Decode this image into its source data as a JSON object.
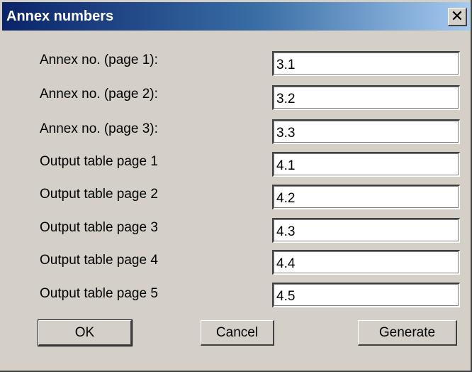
{
  "window": {
    "title": "Annex numbers",
    "close_glyph": "✕"
  },
  "rows": [
    {
      "label": "Annex no. (page 1):",
      "value": "3.1"
    },
    {
      "label": "Annex no. (page 2):",
      "value": "3.2"
    },
    {
      "label": "Annex no. (page 3):",
      "value": "3.3"
    },
    {
      "label": "Output table page  1",
      "value": "4.1"
    },
    {
      "label": "Output table page  2",
      "value": "4.2"
    },
    {
      "label": "Output table page  3",
      "value": "4.3"
    },
    {
      "label": "Output table page  4",
      "value": "4.4"
    },
    {
      "label": "Output table page  5",
      "value": "4.5"
    }
  ],
  "buttons": {
    "ok": "OK",
    "cancel": "Cancel",
    "generate": "Generate"
  },
  "colors": {
    "title_gradient_start": "#0a246a",
    "title_gradient_end": "#a6caf0",
    "dialog_face": "#d4d0c8"
  }
}
